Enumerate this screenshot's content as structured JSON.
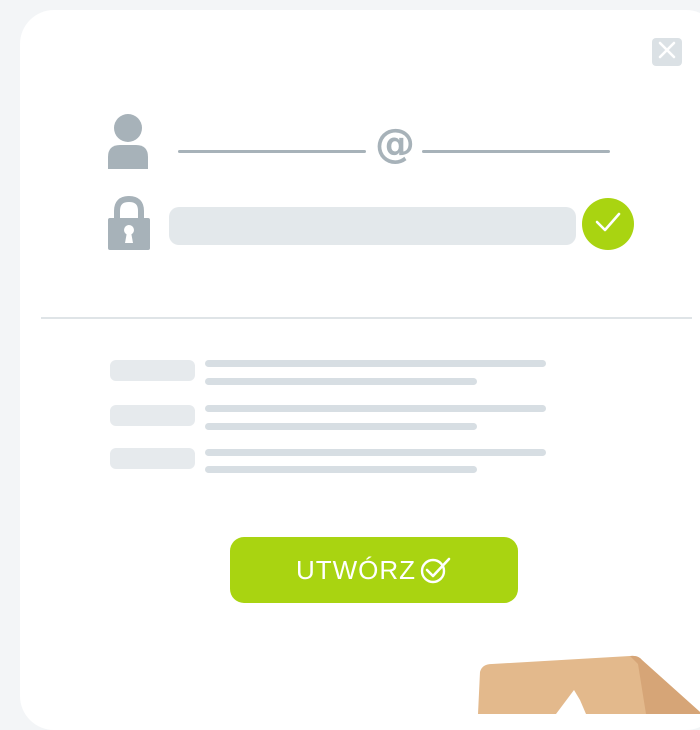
{
  "modal": {
    "close_icon": "close-icon",
    "email": {
      "at_symbol": "@"
    },
    "password": {
      "placeholder": ""
    },
    "list_items_count_note": "",
    "create_button": {
      "label": "UTWÓRZ",
      "icon": "circle-check-icon"
    }
  },
  "colors": {
    "accent": "#a9d411",
    "placeholder_gray": "#e3e8eb",
    "icon_gray": "#a7b2b9",
    "background": "#f3f5f7"
  }
}
